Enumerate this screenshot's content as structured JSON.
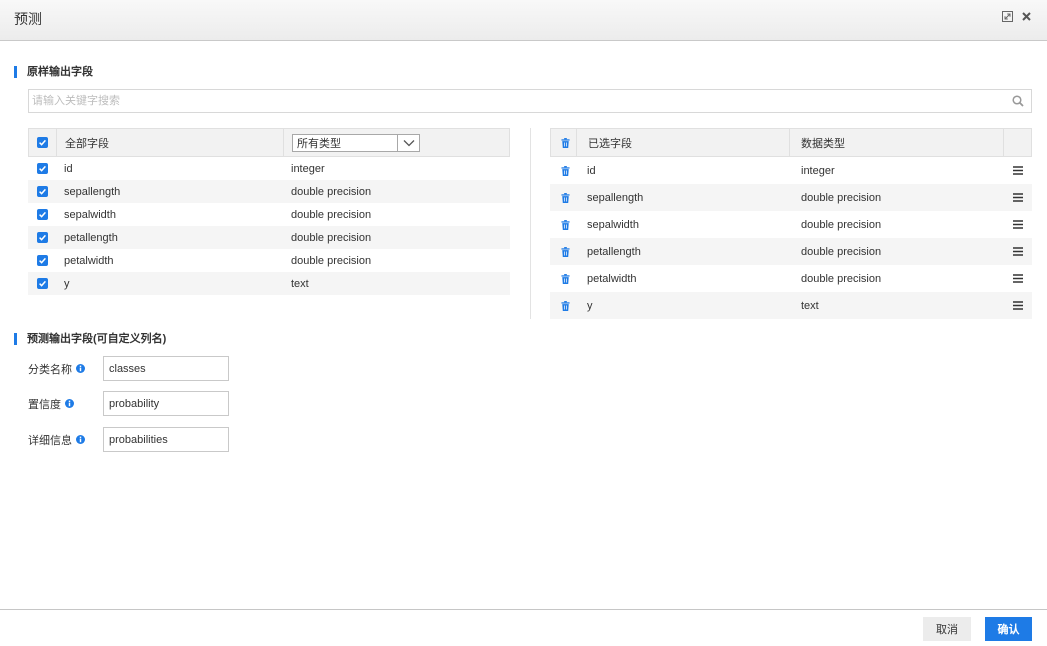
{
  "dialog": {
    "title": "预测",
    "icons": {
      "maximize": "maximize-icon",
      "close": "close-icon"
    }
  },
  "original_output": {
    "title": "原样输出字段",
    "search": {
      "placeholder": "请输入关键字搜索",
      "icon": "search-icon"
    }
  },
  "all_fields": {
    "header_label": "全部字段",
    "all_checked": true,
    "type_filter": {
      "selected": "所有类型",
      "icon": "chevron-down-icon"
    },
    "rows": [
      {
        "name": "id",
        "type": "integer",
        "checked": true
      },
      {
        "name": "sepallength",
        "type": "double precision",
        "checked": true
      },
      {
        "name": "sepalwidth",
        "type": "double precision",
        "checked": true
      },
      {
        "name": "petallength",
        "type": "double precision",
        "checked": true
      },
      {
        "name": "petalwidth",
        "type": "double precision",
        "checked": true
      },
      {
        "name": "y",
        "type": "text",
        "checked": true
      }
    ]
  },
  "selected_fields": {
    "header_name": "已选字段",
    "header_type": "数据类型",
    "icons": {
      "delete": "trash-icon",
      "drag": "drag-handle-icon"
    },
    "rows": [
      {
        "name": "id",
        "type": "integer"
      },
      {
        "name": "sepallength",
        "type": "double precision"
      },
      {
        "name": "sepalwidth",
        "type": "double precision"
      },
      {
        "name": "petallength",
        "type": "double precision"
      },
      {
        "name": "petalwidth",
        "type": "double precision"
      },
      {
        "name": "y",
        "type": "text"
      }
    ]
  },
  "predict_output": {
    "title": "预测输出字段(可自定义列名)",
    "fields": [
      {
        "label": "分类名称",
        "value": "classes",
        "icon": "info-icon"
      },
      {
        "label": "置信度",
        "value": "probability",
        "icon": "info-icon"
      },
      {
        "label": "详细信息",
        "value": "probabilities",
        "icon": "info-icon"
      }
    ]
  },
  "footer": {
    "cancel_label": "取消",
    "confirm_label": "确认"
  },
  "colors": {
    "accent": "#1e7be6",
    "header_bg": "#f2f2f2",
    "row_alt_bg": "#f5f5f5",
    "cancel_bg": "#ececec"
  }
}
